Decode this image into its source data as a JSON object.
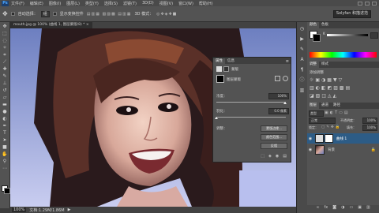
{
  "app": {
    "logo": "Ps"
  },
  "menu": [
    "文件(F)",
    "编辑(E)",
    "图像(I)",
    "图层(L)",
    "类型(Y)",
    "选择(S)",
    "滤镜(T)",
    "3D(D)",
    "视图(V)",
    "窗口(W)",
    "帮助(H)"
  ],
  "options": {
    "mode_label": "自动选择：",
    "mode_value": "组",
    "show_transform": "显示变换控件",
    "mode_3d": "3D 模式：",
    "workspace": "Solyfan 和描述范"
  },
  "document": {
    "tab_title": "mouth.jpg @ 100% (曲线 1, 图层蒙版/8) *",
    "zoom": "100%",
    "doc_info": "文档:1.29M/1.86M"
  },
  "properties": {
    "tabs": [
      "属性",
      "信息"
    ],
    "mask_label": "蒙版",
    "layer_mask": "图层蒙版",
    "density_label": "浓度：",
    "density_value": "100%",
    "feather_label": "羽化：",
    "feather_value": "0.0 像素",
    "refine_label": "调整：",
    "btn_mask_edge": "蒙版边缘...",
    "btn_color_range": "颜色范围...",
    "btn_invert": "反相"
  },
  "right_panel": {
    "color_tabs": [
      "颜色",
      "色板"
    ],
    "adjust_tabs": [
      "调整",
      "样式"
    ],
    "adjust_label": "添加调整",
    "layers_tabs": [
      "图层",
      "通道",
      "路径"
    ],
    "kind_label": "类型",
    "blend_mode": "正常",
    "opacity_label": "不透明度：",
    "opacity_value": "100%",
    "lock_label": "锁定：",
    "fill_label": "填充：",
    "fill_value": "100%",
    "layers": [
      {
        "name": "曲线 1",
        "type": "adjustment",
        "selected": true
      },
      {
        "name": "背景",
        "type": "image",
        "selected": false
      }
    ]
  },
  "colors": {
    "panel": "#535353",
    "selected_layer": "#2d5c86",
    "accent": "#3c80c5"
  },
  "icons": [
    "move-tool-icon",
    "marquee-tool-icon",
    "lasso-tool-icon",
    "magic-wand-icon",
    "crop-tool-icon",
    "eyedropper-icon",
    "healing-brush-icon",
    "brush-tool-icon",
    "clone-stamp-icon",
    "history-brush-icon",
    "eraser-icon",
    "gradient-tool-icon",
    "blur-tool-icon",
    "dodge-tool-icon",
    "pen-tool-icon",
    "type-tool-icon",
    "path-select-icon",
    "shape-tool-icon",
    "hand-tool-icon",
    "zoom-tool-icon"
  ]
}
